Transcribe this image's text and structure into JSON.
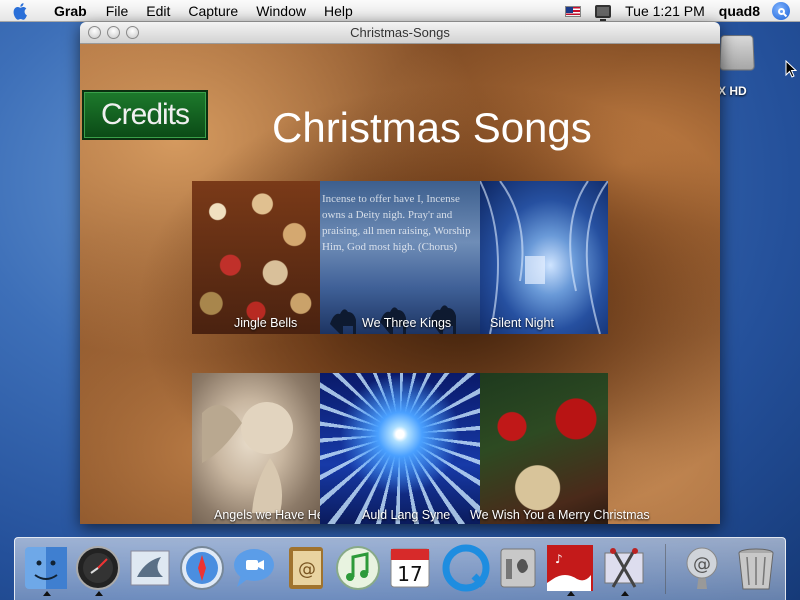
{
  "menubar": {
    "app_name": "Grab",
    "items": [
      "File",
      "Edit",
      "Capture",
      "Window",
      "Help"
    ],
    "clock": "Tue 1:21 PM",
    "user": "quad8"
  },
  "desktop": {
    "hd_label": "X HD"
  },
  "window": {
    "title": "Christmas-Songs",
    "credits_label": "Credits",
    "page_title": "Christmas Songs",
    "songs": [
      {
        "label": "Jingle Bells"
      },
      {
        "label": "We Three Kings",
        "verse_text": "Incense to offer have I, Incense owns a Deity nigh. Pray'r and praising, all men raising, Worship Him, God most high. (Chorus)"
      },
      {
        "label": "Silent Night"
      },
      {
        "label": "Angels we Have Heard on High"
      },
      {
        "label": "Auld Lang Syne"
      },
      {
        "label": "We Wish You a Merry Christmas"
      }
    ]
  },
  "dock": {
    "items": [
      "finder-icon",
      "dashboard-icon",
      "mail-icon",
      "safari-icon",
      "ichat-icon",
      "address-book-icon",
      "itunes-icon",
      "ical-icon",
      "quicktime-icon",
      "system-preferences-icon",
      "christmas-songs-icon",
      "grab-icon",
      "internet-icon",
      "trash-icon"
    ]
  }
}
